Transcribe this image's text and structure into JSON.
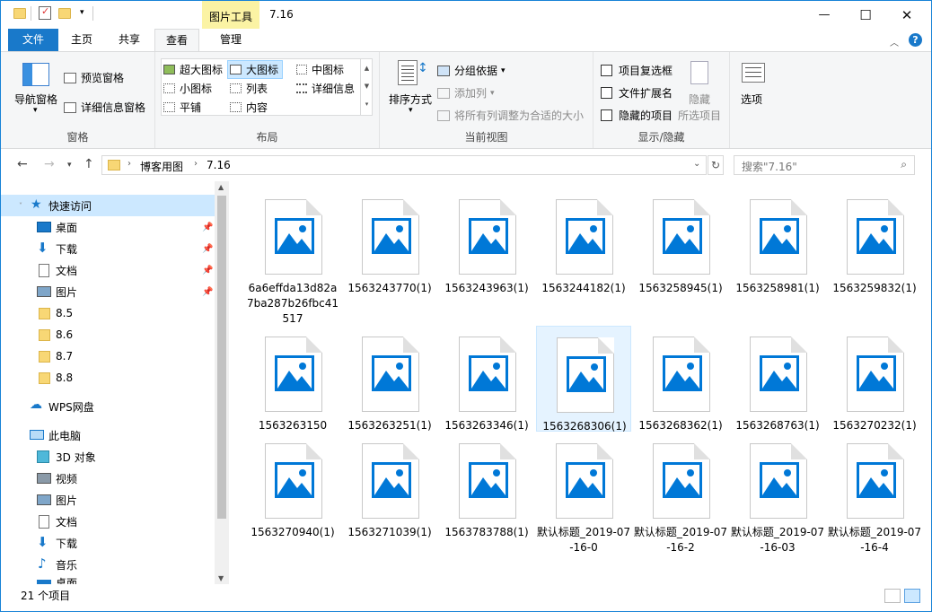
{
  "window": {
    "title": "7.16",
    "context_tab_group": "图片工具",
    "minimize": "—",
    "maximize": "☐",
    "close": "✕"
  },
  "tabs": {
    "file": "文件",
    "home": "主页",
    "share": "共享",
    "view": "查看",
    "manage": "管理"
  },
  "ribbon": {
    "panes": {
      "label": "窗格",
      "nav_pane": "导航窗格",
      "preview_pane": "预览窗格",
      "details_pane": "详细信息窗格"
    },
    "layout": {
      "label": "布局",
      "items": [
        "超大图标",
        "大图标",
        "中图标",
        "小图标",
        "列表",
        "详细信息",
        "平铺",
        "内容"
      ]
    },
    "current_view": {
      "label": "当前视图",
      "sort_by": "排序方式",
      "group_by": "分组依据",
      "add_columns": "添加列",
      "fit_columns": "将所有列调整为合适的大小"
    },
    "show_hide": {
      "label": "显示/隐藏",
      "item_checkboxes": "项目复选框",
      "file_extensions": "文件扩展名",
      "hidden_items": "隐藏的项目",
      "hide_selected_1": "隐藏",
      "hide_selected_2": "所选项目"
    },
    "options": {
      "label": "选项"
    }
  },
  "address": {
    "path": [
      "博客用图",
      "7.16"
    ],
    "search_placeholder": "搜索\"7.16\""
  },
  "sidebar": {
    "quick_access": "快速访问",
    "items": [
      {
        "label": "桌面",
        "pinned": true
      },
      {
        "label": "下载",
        "pinned": true
      },
      {
        "label": "文档",
        "pinned": true
      },
      {
        "label": "图片",
        "pinned": true
      },
      {
        "label": "8.5",
        "pinned": false
      },
      {
        "label": "8.6",
        "pinned": false
      },
      {
        "label": "8.7",
        "pinned": false
      },
      {
        "label": "8.8",
        "pinned": false
      }
    ],
    "wps": "WPS网盘",
    "this_pc": "此电脑",
    "pc_items": [
      "3D 对象",
      "视频",
      "图片",
      "文档",
      "下载",
      "音乐",
      "桌面"
    ]
  },
  "files": [
    "6a6effda13d82a7ba287b26fbc41517",
    "1563243770(1)",
    "1563243963(1)",
    "1563244182(1)",
    "1563258945(1)",
    "1563258981(1)",
    "1563259832(1)",
    "1563263150",
    "1563263251(1)",
    "1563263346(1)",
    "1563268306(1)",
    "1563268362(1)",
    "1563268763(1)",
    "1563270232(1)",
    "1563270940(1)",
    "1563271039(1)",
    "1563783788(1)",
    "默认标题_2019-07-16-0",
    "默认标题_2019-07-16-2",
    "默认标题_2019-07-16-03",
    "默认标题_2019-07-16-4"
  ],
  "selected_index": 10,
  "status": {
    "count": "21 个项目"
  },
  "colors": {
    "accent": "#1979ca",
    "context_tab": "#fbf3a4",
    "folder": "#f8d775",
    "image_icon": "#0078d7",
    "selection": "#e5f3ff"
  }
}
